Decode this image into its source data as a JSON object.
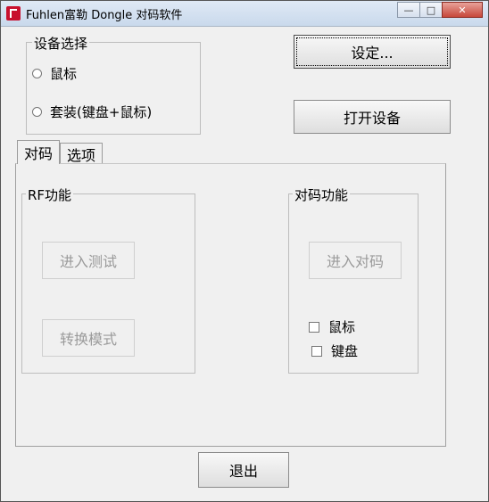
{
  "window": {
    "title": "Fuhlen富勒 Dongle 对码软件"
  },
  "device_group": {
    "legend": "设备选择",
    "options": [
      "鼠标",
      "套装(键盘+鼠标)"
    ]
  },
  "buttons": {
    "settings": "设定...",
    "open_device": "打开设备",
    "exit": "退出"
  },
  "tabs": [
    {
      "label": "对码"
    },
    {
      "label": "选项"
    }
  ],
  "rf_group": {
    "legend": "RF功能",
    "enter_test": "进入测试",
    "switch_mode": "转换模式"
  },
  "pair_group": {
    "legend": "对码功能",
    "enter_pair": "进入对码",
    "mouse": "鼠标",
    "keyboard": "键盘"
  }
}
